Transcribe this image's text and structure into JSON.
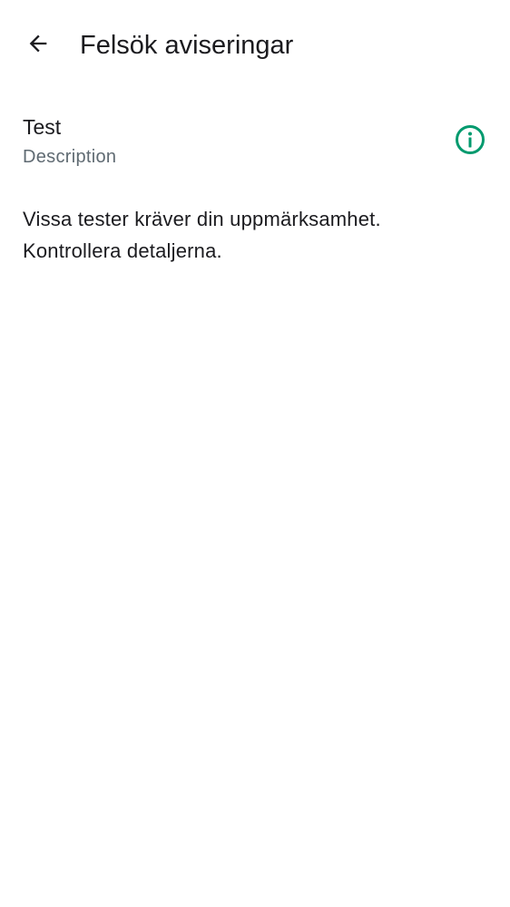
{
  "header": {
    "back_icon": "arrow-back-icon",
    "title": "Felsök aviseringar"
  },
  "test_item": {
    "title": "Test",
    "description": "Description",
    "info_icon": "info-circle-icon",
    "info_icon_color": "#009a6e"
  },
  "message": {
    "line1": "Vissa tester kräver din uppmärksamhet.",
    "line2": "Kontrollera detaljerna."
  }
}
